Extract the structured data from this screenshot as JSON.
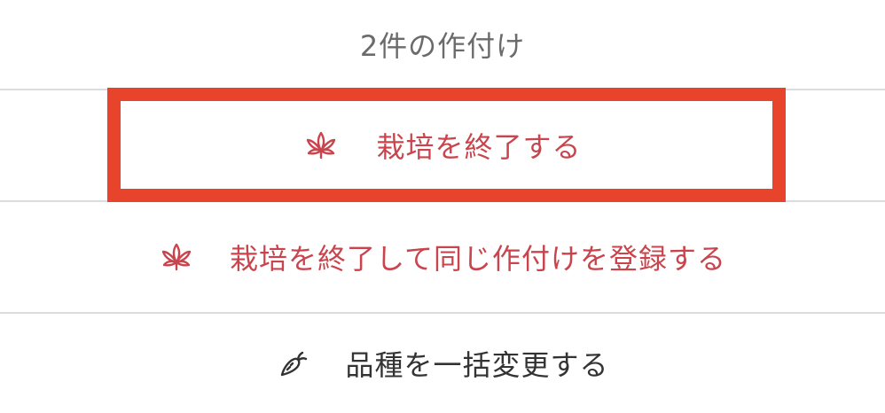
{
  "header": {
    "title": "2件の作付け"
  },
  "actions": [
    {
      "label": "栽培を終了する",
      "icon": "cannabis-leaf-icon",
      "color": "#c9444c"
    },
    {
      "label": "栽培を終了して同じ作付けを登録する",
      "icon": "cannabis-leaf-icon",
      "color": "#c9444c"
    },
    {
      "label": "品種を一括変更する",
      "icon": "carrot-icon",
      "color": "#333333"
    }
  ],
  "highlight": {
    "color": "#e8442c"
  }
}
